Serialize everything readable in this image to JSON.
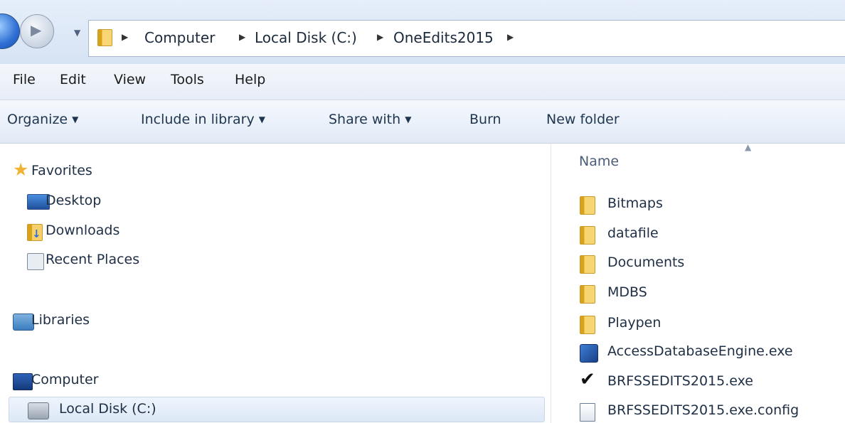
{
  "address": {
    "crumbs": [
      "Computer",
      "Local Disk (C:)",
      "OneEdits2015"
    ]
  },
  "menu": [
    "File",
    "Edit",
    "View",
    "Tools",
    "Help"
  ],
  "toolbar": {
    "organize": "Organize",
    "include_in_library": "Include in library",
    "share_with": "Share with",
    "burn": "Burn",
    "new_folder": "New folder"
  },
  "nav": {
    "favorites": "Favorites",
    "desktop": "Desktop",
    "downloads": "Downloads",
    "recent_places": "Recent Places",
    "libraries": "Libraries",
    "computer": "Computer",
    "local_disk": "Local Disk (C:)"
  },
  "files": {
    "column_name": "Name",
    "items": [
      {
        "name": "Bitmaps",
        "icon": "folder-icon"
      },
      {
        "name": "datafile",
        "icon": "folder-icon"
      },
      {
        "name": "Documents",
        "icon": "folder-icon"
      },
      {
        "name": "MDBS",
        "icon": "folder-icon"
      },
      {
        "name": "Playpen",
        "icon": "folder-icon"
      },
      {
        "name": "AccessDatabaseEngine.exe",
        "icon": "installer-icon"
      },
      {
        "name": "BRFSSEDITS2015.exe",
        "icon": "checkmark-icon"
      },
      {
        "name": "BRFSSEDITS2015.exe.config",
        "icon": "config-file-icon"
      }
    ]
  },
  "colors": {
    "accent": "#2f6fd4",
    "text": "#1e2f45",
    "folder": "#f7d572"
  }
}
